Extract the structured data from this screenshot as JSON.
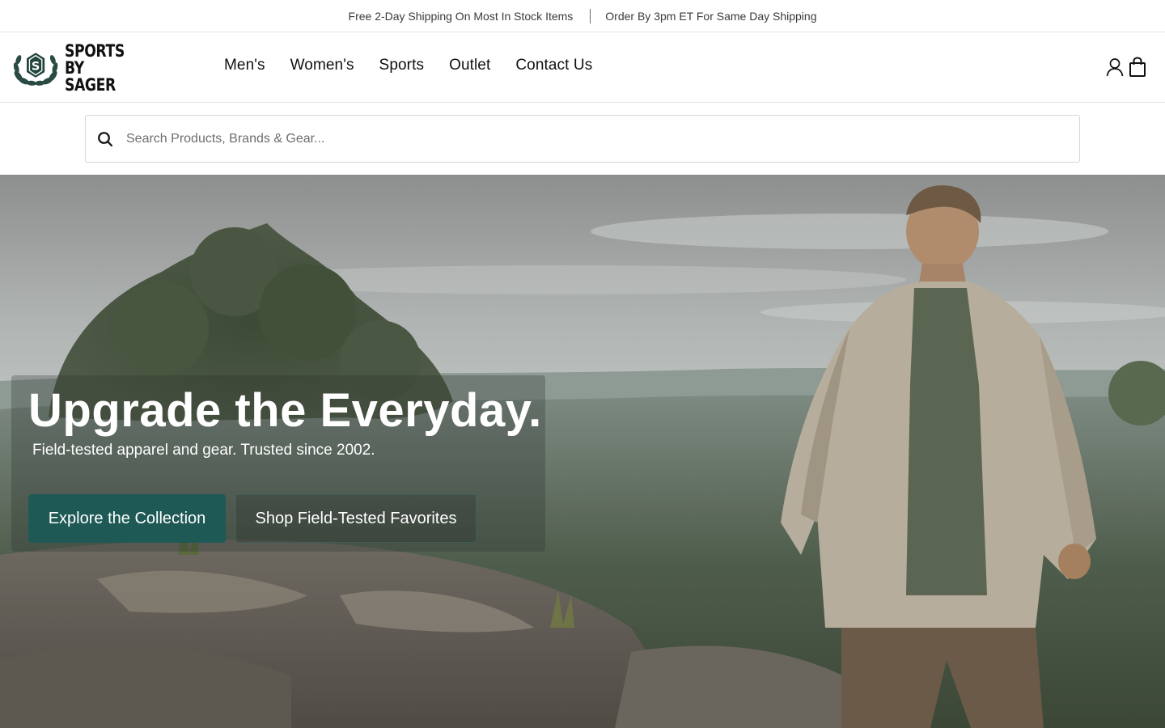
{
  "announcement": {
    "left_text": "Free 2-Day Shipping On Most In Stock Items",
    "right_text": "Order By 3pm ET For Same Day Shipping"
  },
  "header": {
    "logo": {
      "line1": "SPORTS",
      "line2": "BY SAGER",
      "icon": "laurel-s-emblem-icon"
    },
    "nav": [
      {
        "label": "Men's"
      },
      {
        "label": "Women's"
      },
      {
        "label": "Sports"
      },
      {
        "label": "Outlet"
      },
      {
        "label": "Contact Us"
      }
    ],
    "icons": [
      "account-icon",
      "cart-icon"
    ]
  },
  "search": {
    "placeholder": "Search Products, Brands & Gear...",
    "value": "",
    "icon": "search-icon"
  },
  "hero": {
    "title": "Upgrade the Everyday.",
    "subtitle": "Field-tested apparel and gear. Trusted since 2002.",
    "primary_button": "Explore the Collection",
    "secondary_button": "Shop Field-Tested Favorites"
  },
  "colors": {
    "accent": "#1f5956",
    "logo_green": "#24453f",
    "text": "#111111"
  }
}
